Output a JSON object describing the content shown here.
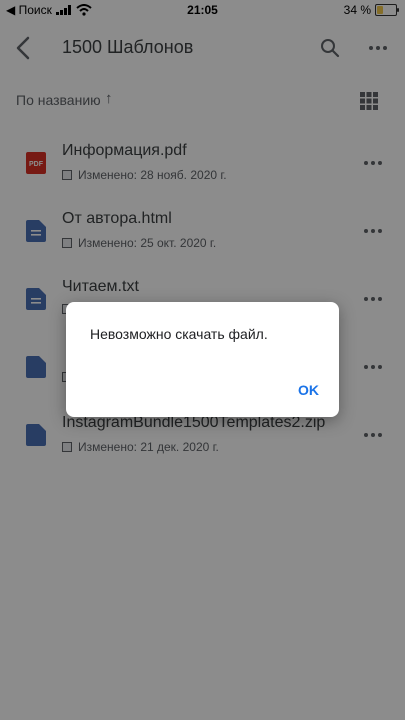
{
  "status_bar": {
    "carrier": "◀ Поиск",
    "time": "21:05",
    "battery": "34 %",
    "battery_level": 0.34
  },
  "header": {
    "title": "1500 Шаблонов",
    "back_icon": "chevron-left-icon",
    "search_icon": "search-icon",
    "more_icon": "more-horizontal-icon"
  },
  "sort": {
    "label": "По названию",
    "arrow": "↑",
    "view_icon": "grid-view-icon"
  },
  "files": [
    {
      "name": "Информация.pdf",
      "meta": "Изменено: 28 нояб. 2020 г.",
      "type": "pdf",
      "color": "#d93025"
    },
    {
      "name": "От автора.html",
      "meta": "Изменено: 25 окт. 2020 г.",
      "type": "doc",
      "color": "#4a6fb5"
    },
    {
      "name": "Читаем.txt",
      "meta": "",
      "type": "doc",
      "color": "#4a6fb5"
    },
    {
      "name": "",
      "meta": "",
      "type": "doc",
      "color": "#4a6fb5"
    },
    {
      "name": "InstagramBundle1500Templates2.zip",
      "meta": "Изменено: 21 дек. 2020 г.",
      "type": "doc",
      "color": "#4a6fb5"
    }
  ],
  "dialog": {
    "message": "Невозможно скачать файл.",
    "ok_label": "OK"
  },
  "colors": {
    "accent": "#1a73e8",
    "overlay": "rgba(0,0,0,0.45)"
  }
}
